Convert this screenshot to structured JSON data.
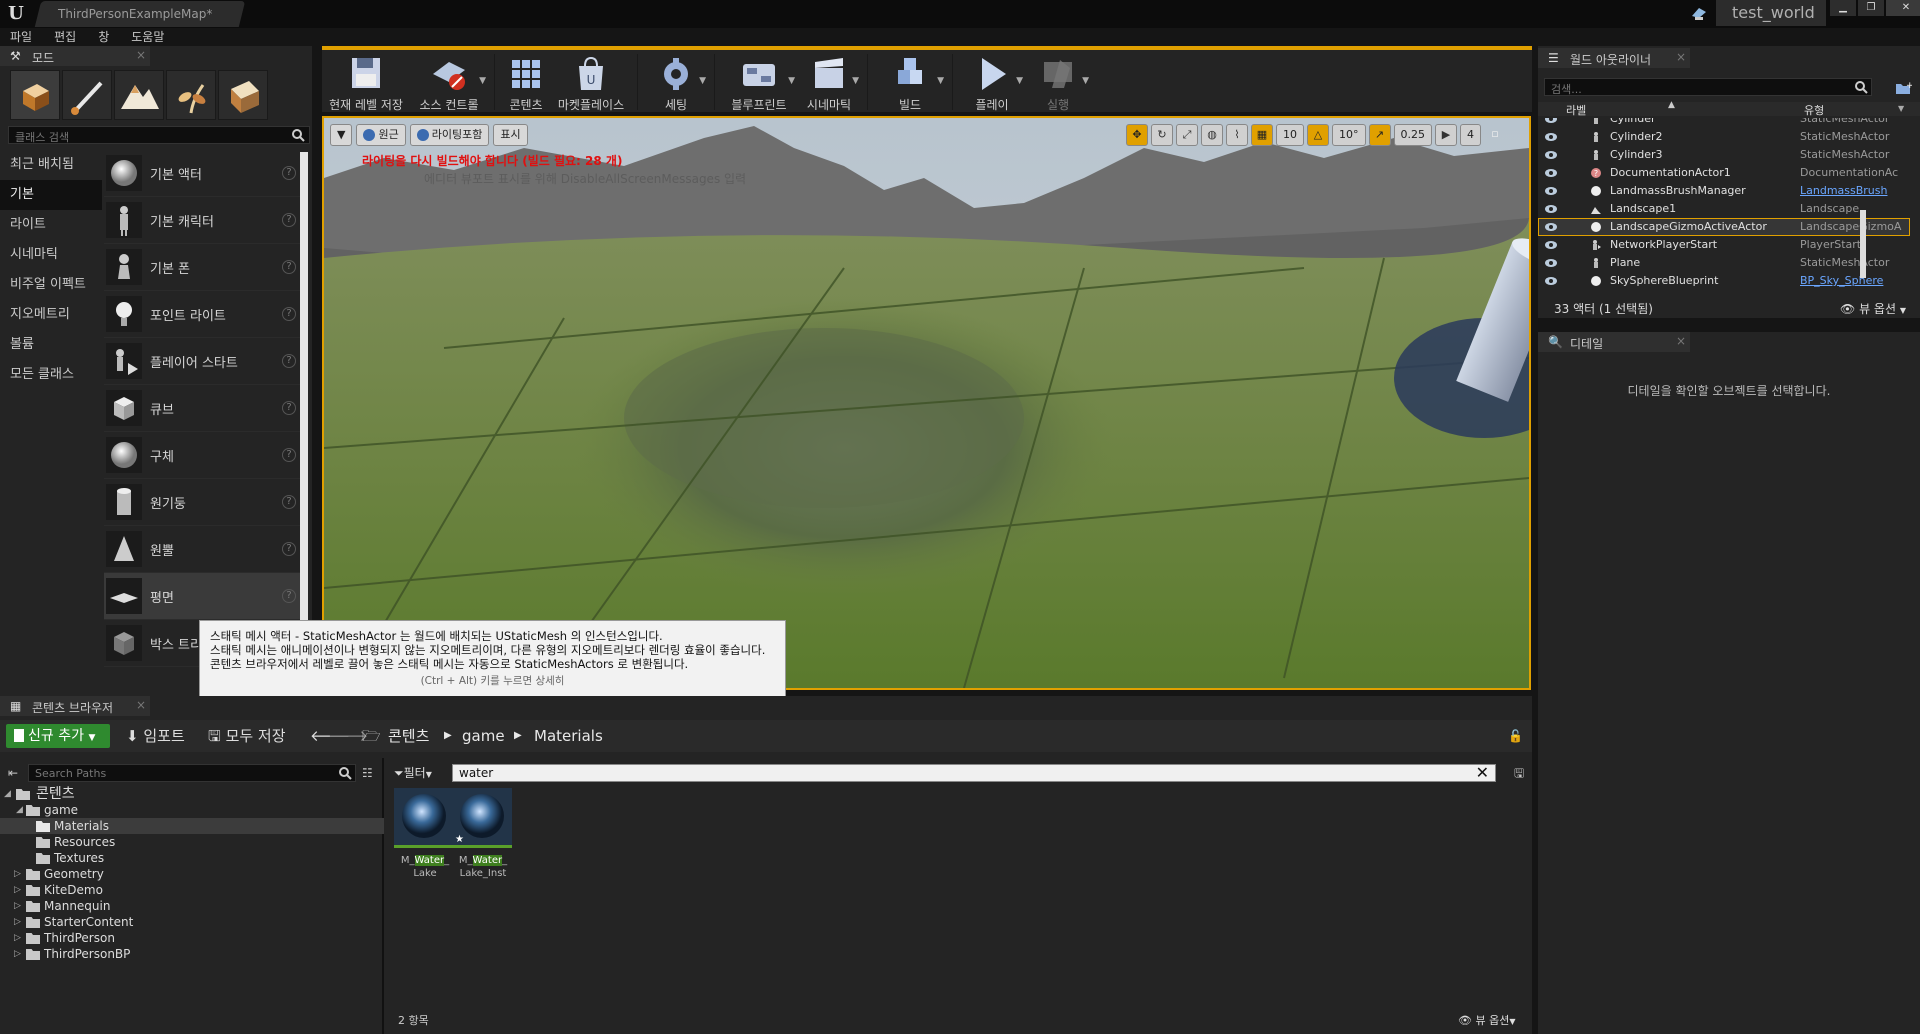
{
  "titlebar": {
    "doc_tab": "ThirdPersonExampleMap*",
    "project": "test_world"
  },
  "menu": [
    "파일",
    "편집",
    "창",
    "도움말"
  ],
  "modes": {
    "tab": "모드",
    "search_placeholder": "클래스 검색",
    "categories": [
      "최근 배치됨",
      "기본",
      "라이트",
      "시네마틱",
      "비주얼 이펙트",
      "지오메트리",
      "볼륨",
      "모든 클래스"
    ],
    "items": [
      "기본 액터",
      "기본 캐릭터",
      "기본 폰",
      "포인트 라이트",
      "플레이어 스타트",
      "큐브",
      "구체",
      "원기둥",
      "원뿔",
      "평면",
      "박스 트리거"
    ]
  },
  "toolbar": [
    {
      "label": "현재 레벨 저장"
    },
    {
      "label": "소스 컨트롤"
    },
    {
      "label": "콘텐츠"
    },
    {
      "label": "마켓플레이스"
    },
    {
      "label": "세팅"
    },
    {
      "label": "블루프린트"
    },
    {
      "label": "시네마틱"
    },
    {
      "label": "빌드"
    },
    {
      "label": "플레이"
    },
    {
      "label": "실행"
    }
  ],
  "viewport": {
    "perspective": "원근",
    "lighting": "라이팅포함",
    "show": "표시",
    "warning": "라이팅을 다시 빌드해야 합니다 (빌드 필요: 28 개)",
    "ghost": "에디터 뷰포트 표시를 위해 DisableAllScreenMessages 입력",
    "grid_snap": "10",
    "rot_snap": "10°",
    "scale_snap": "0.25",
    "cam_speed": "4"
  },
  "tooltip": {
    "line1": "스태틱 메시 액터 - StaticMeshActor 는 월드에 배치되는 UStaticMesh 의 인스턴스입니다.",
    "line2": "스태틱 메시는 애니메이션이나 변형되지 않는 지오메트리이며, 다른 유형의 지오메트리보다 렌더링 효율이 좋습니다.",
    "line3": "콘텐츠 브라우저에서 레벨로 끌어 놓은 스태틱 메시는 자동으로 StaticMeshActors 로 변환됩니다.",
    "hint": "(Ctrl + Alt) 키를 누르면 상세히"
  },
  "outliner": {
    "tab": "월드 아웃라이너",
    "search_placeholder": "검색...",
    "col_label": "라벨",
    "col_type": "유형",
    "rows": [
      {
        "label": "Cylinder",
        "type": "StaticMeshActor"
      },
      {
        "label": "Cylinder2",
        "type": "StaticMeshActor"
      },
      {
        "label": "Cylinder3",
        "type": "StaticMeshActor"
      },
      {
        "label": "DocumentationActor1",
        "type": "DocumentationAc"
      },
      {
        "label": "LandmassBrushManager",
        "type": "LandmassBrush"
      },
      {
        "label": "Landscape1",
        "type": "Landscape"
      },
      {
        "label": "LandscapeGizmoActiveActor",
        "type": "LandscapeGizmoA"
      },
      {
        "label": "NetworkPlayerStart",
        "type": "PlayerStart"
      },
      {
        "label": "Plane",
        "type": "StaticMeshActor"
      },
      {
        "label": "SkySphereBlueprint",
        "type": "BP_Sky_Sphere"
      }
    ],
    "footer": "33 액터 (1 선택됨)",
    "view_options": "뷰 옵션"
  },
  "details": {
    "tab": "디테일",
    "empty": "디테일을 확인할 오브젝트를 선택합니다."
  },
  "content_browser": {
    "tab": "콘텐츠 브라우저",
    "add_new": "신규 추가",
    "import": "임포트",
    "save_all": "모두 저장",
    "crumbs": [
      "콘텐츠",
      "game",
      "Materials"
    ],
    "path_search_placeholder": "Search Paths",
    "tree": [
      {
        "label": "콘텐츠",
        "level": 0
      },
      {
        "label": "game",
        "level": 1
      },
      {
        "label": "Materials",
        "level": 2
      },
      {
        "label": "Resources",
        "level": 2
      },
      {
        "label": "Textures",
        "level": 2
      },
      {
        "label": "Geometry",
        "level": 1
      },
      {
        "label": "KiteDemo",
        "level": 1
      },
      {
        "label": "Mannequin",
        "level": 1
      },
      {
        "label": "StarterContent",
        "level": 1
      },
      {
        "label": "ThirdPerson",
        "level": 1
      },
      {
        "label": "ThirdPersonBP",
        "level": 1
      }
    ],
    "filter": "필터",
    "search_value": "water",
    "assets": [
      {
        "pre": "M_",
        "hl": "Water",
        "post": "_",
        "line2": "Lake"
      },
      {
        "pre": "M_",
        "hl": "Water",
        "post": "_",
        "line2": "Lake_Inst"
      }
    ],
    "count": "2 항목",
    "view_options": "뷰 옵션"
  },
  "colors": {
    "accent": "#e0a000",
    "add_new": "#2f8a2f",
    "warning": "#e01010",
    "link": "#6aa6ff"
  }
}
